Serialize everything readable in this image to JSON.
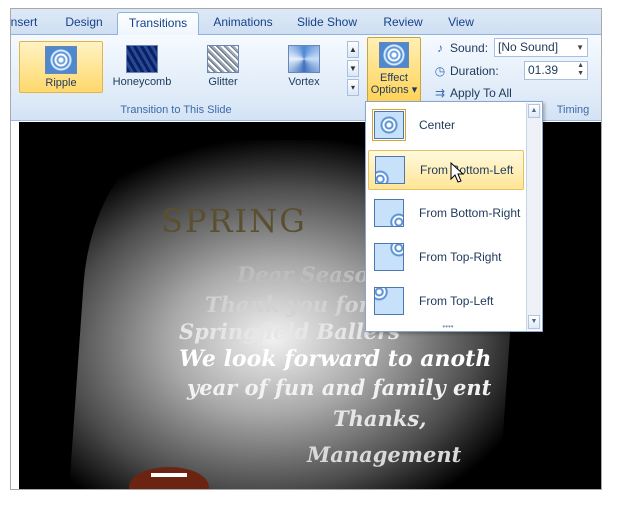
{
  "tabs": [
    {
      "label": "nsert",
      "active": false
    },
    {
      "label": "Design",
      "active": false
    },
    {
      "label": "Transitions",
      "active": true
    },
    {
      "label": "Animations",
      "active": false
    },
    {
      "label": "Slide Show",
      "active": false
    },
    {
      "label": "Review",
      "active": false
    },
    {
      "label": "View",
      "active": false
    }
  ],
  "gallery": {
    "items": [
      {
        "label": "Ripple",
        "selected": true
      },
      {
        "label": "Honeycomb",
        "selected": false
      },
      {
        "label": "Glitter",
        "selected": false
      },
      {
        "label": "Vortex",
        "selected": false
      }
    ],
    "group_label": "Transition to This Slide"
  },
  "effect_options": {
    "label_line1": "Effect",
    "label_line2": "Options"
  },
  "timing": {
    "sound_label": "Sound:",
    "sound_value": "[No Sound]",
    "duration_label": "Duration:",
    "duration_value": "01.39",
    "apply_label": "Apply To All",
    "group_label": "Timing"
  },
  "dropdown": {
    "items": [
      {
        "label": "Center",
        "checked": true,
        "hovered": false
      },
      {
        "label": "From Bottom-Left",
        "checked": false,
        "hovered": true
      },
      {
        "label": "From Bottom-Right",
        "checked": false,
        "hovered": false
      },
      {
        "label": "From Top-Right",
        "checked": false,
        "hovered": false
      },
      {
        "label": "From Top-Left",
        "checked": false,
        "hovered": false
      }
    ]
  },
  "slide": {
    "title": "SPRING",
    "lines": [
      "Dear Season",
      "Thank you for y",
      "Springfield Ballers",
      "We look forward to anoth",
      "year of fun and family ent",
      "Thanks,",
      "Management"
    ]
  },
  "colors": {
    "ribbon_text": "#1e395b",
    "selected_gradient_top": "#fff3c4",
    "selected_gradient_bottom": "#ffd86b",
    "slide_background": "#000000"
  }
}
